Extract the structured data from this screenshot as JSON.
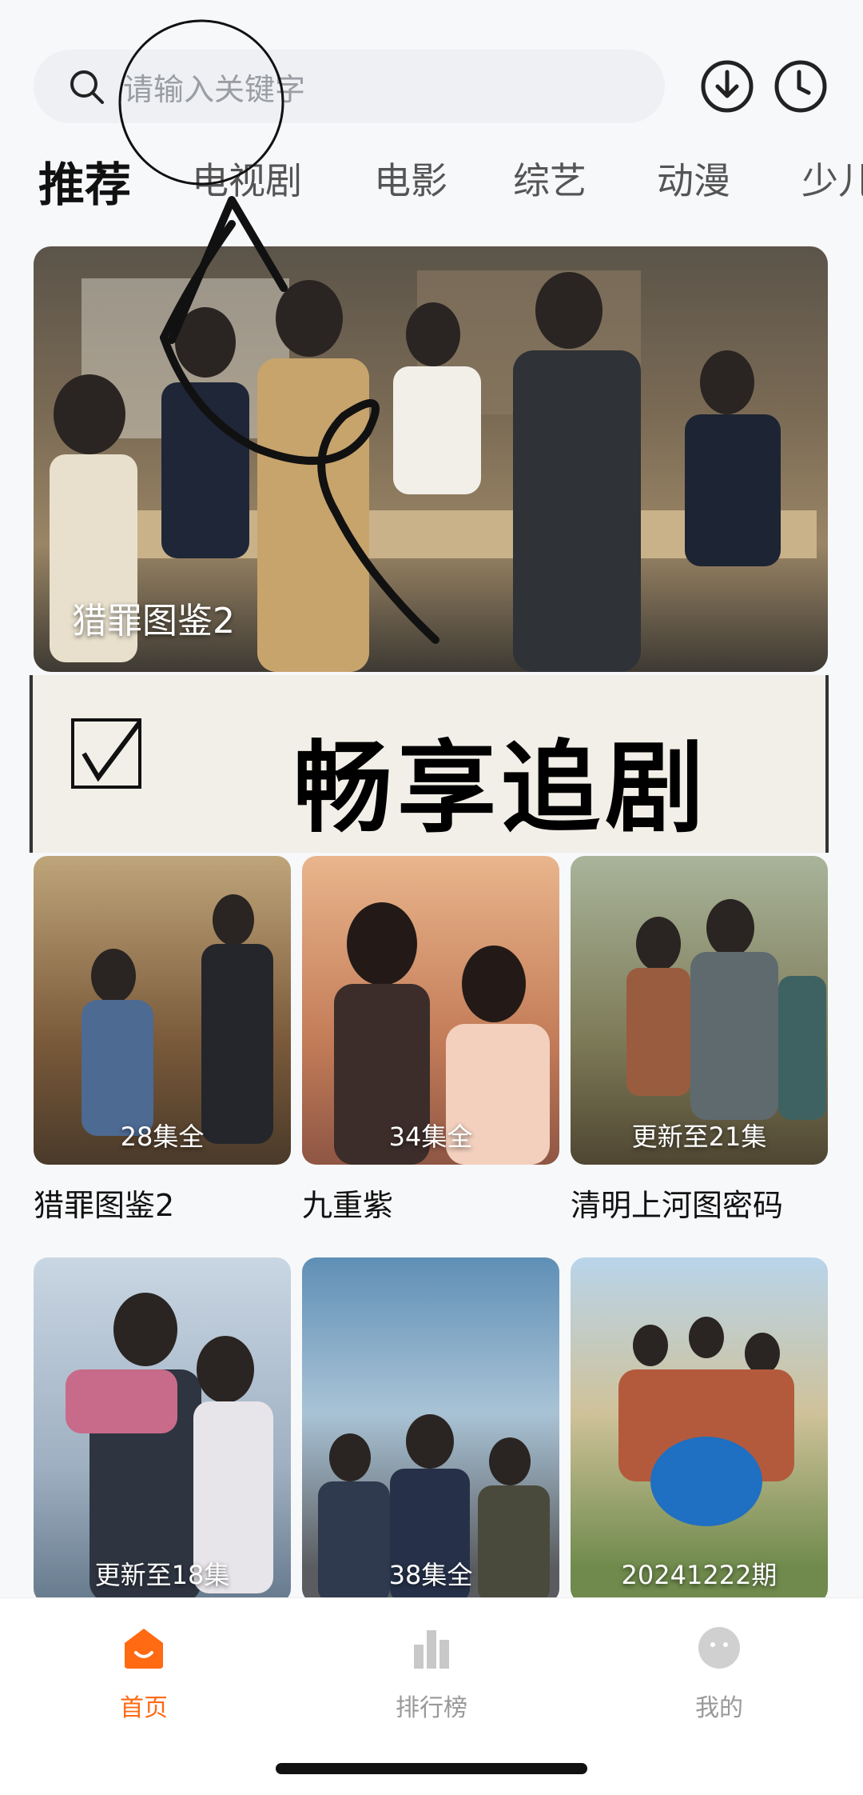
{
  "search": {
    "placeholder": "请输入关键字"
  },
  "tabs": [
    {
      "label": "推荐"
    },
    {
      "label": "电视剧"
    },
    {
      "label": "电影"
    },
    {
      "label": "综艺"
    },
    {
      "label": "动漫"
    },
    {
      "label": "少儿"
    }
  ],
  "banner": {
    "title": "猎罪图鉴2"
  },
  "overlay": {
    "text": "畅享追剧"
  },
  "row1": [
    {
      "episodes": "28集全",
      "title": "猎罪图鉴2"
    },
    {
      "episodes": "34集全",
      "title": "九重紫"
    },
    {
      "episodes": "更新至21集",
      "title": "清明上河图密码"
    }
  ],
  "row2": [
    {
      "episodes": "更新至18集"
    },
    {
      "episodes": "38集全"
    },
    {
      "episodes": "20241222期"
    }
  ],
  "nav": [
    {
      "label": "首页"
    },
    {
      "label": "排行榜"
    },
    {
      "label": "我的"
    }
  ],
  "colors": {
    "accent": "#ff6a13"
  }
}
